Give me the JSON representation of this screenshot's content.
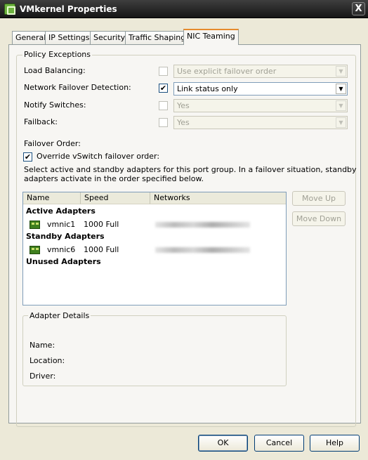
{
  "window": {
    "title": "VMkernel Properties",
    "close_label": "X"
  },
  "tabs": [
    {
      "label": "General"
    },
    {
      "label": "IP Settings"
    },
    {
      "label": "Security"
    },
    {
      "label": "Traffic Shaping"
    },
    {
      "label": "NIC Teaming",
      "active": true
    }
  ],
  "policy_exceptions": {
    "legend": "Policy Exceptions",
    "load_balancing": {
      "label": "Load Balancing:",
      "checked": false,
      "value": "Use explicit failover order",
      "enabled": false
    },
    "network_failover_detection": {
      "label": "Network Failover Detection:",
      "checked": true,
      "check_mark": "✔",
      "value": "Link status only",
      "enabled": true
    },
    "notify_switches": {
      "label": "Notify Switches:",
      "checked": false,
      "value": "Yes",
      "enabled": false
    },
    "failback": {
      "label": "Failback:",
      "checked": false,
      "value": "Yes",
      "enabled": false
    },
    "failover_order_label": "Failover Order:",
    "override": {
      "label": "Override vSwitch failover order:",
      "checked": true,
      "check_mark": "✔"
    },
    "description_line1": "Select active and standby adapters for this port group.  In a failover situation, standby",
    "description_line2": "adapters activate  in the order specified below."
  },
  "adapter_list": {
    "columns": [
      "Name",
      "Speed",
      "Networks"
    ],
    "sections": {
      "active": "Active Adapters",
      "standby": "Standby Adapters",
      "unused": "Unused Adapters"
    },
    "active_adapters": [
      {
        "name": "vmnic1",
        "speed": "1000 Full"
      }
    ],
    "standby_adapters": [
      {
        "name": "vmnic6",
        "speed": "1000 Full"
      }
    ]
  },
  "side_buttons": {
    "move_up": "Move Up",
    "move_down": "Move Down"
  },
  "adapter_details": {
    "legend": "Adapter Details",
    "name_label": "Name:",
    "location_label": "Location:",
    "driver_label": "Driver:"
  },
  "footer": {
    "ok": "OK",
    "cancel": "Cancel",
    "help": "Help"
  },
  "colors": {
    "titlebar": "#222222",
    "active_tab_accent": "#e68b2c",
    "window_bg": "#ece9d8"
  },
  "icons": {
    "title": "vmware-window-icon",
    "nic": "network-adapter-icon",
    "dropdown": "chevron-down-icon"
  }
}
